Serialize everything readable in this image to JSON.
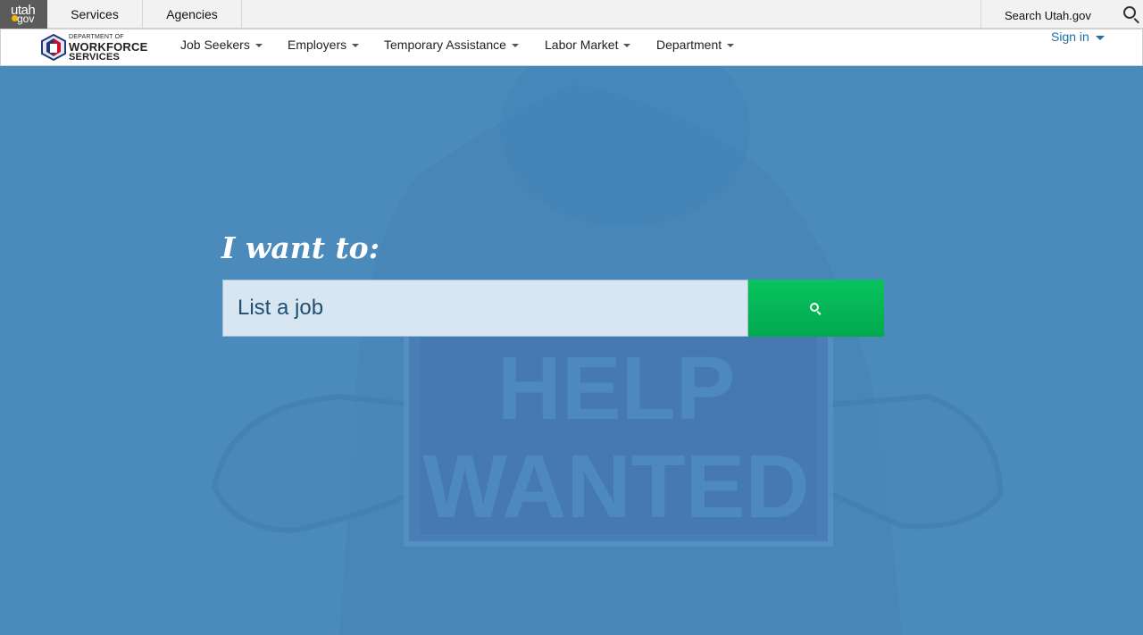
{
  "utah_bar": {
    "logo_top": "utah",
    "logo_bottom": "gov",
    "services_label": "Services",
    "agencies_label": "Agencies",
    "search_label": "Search Utah.gov"
  },
  "dws_nav": {
    "brand_line1": "DEPARTMENT OF",
    "brand_line2": "WORKFORCE",
    "brand_line3": "SERVICES",
    "items": [
      {
        "label": "Job Seekers"
      },
      {
        "label": "Employers"
      },
      {
        "label": "Temporary Assistance"
      },
      {
        "label": "Labor Market"
      },
      {
        "label": "Department"
      }
    ],
    "signin_label": "Sign in"
  },
  "hero": {
    "heading": "I want to:",
    "search_value": "List a job",
    "sign_text_line1": "HELP",
    "sign_text_line2": "WANTED"
  },
  "colors": {
    "hero_bg": "#4a8bbc",
    "search_button": "#02b357",
    "link_blue": "#1d6fa8",
    "logo_red": "#c8102e",
    "logo_navy": "#1f3a7a"
  },
  "icons": {
    "utah_search": "search-icon",
    "hero_search": "search-icon",
    "nav_dropdown": "chevron-down-icon"
  }
}
